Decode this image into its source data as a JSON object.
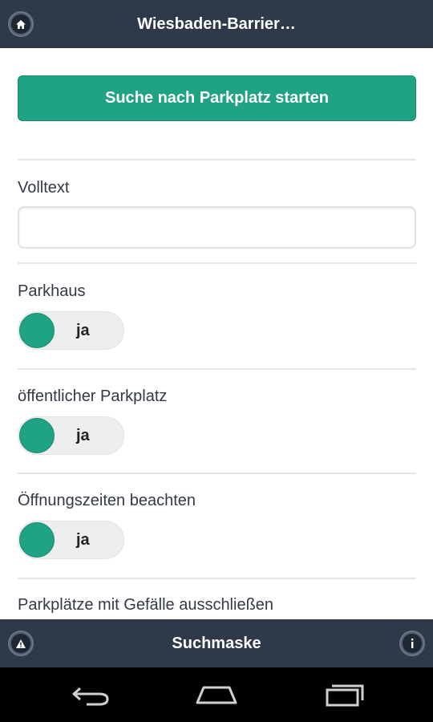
{
  "header": {
    "title": "Wiesbaden-Barrier…",
    "home_icon": "home-icon"
  },
  "search_button": {
    "label": "Suche nach Parkplatz starten"
  },
  "fulltext": {
    "label": "Volltext",
    "value": "",
    "placeholder": ""
  },
  "filters": [
    {
      "label": "Parkhaus",
      "toggle": "ja"
    },
    {
      "label": "öffentlicher Parkplatz",
      "toggle": "ja"
    },
    {
      "label": "Öffnungszeiten beachten",
      "toggle": "ja"
    },
    {
      "label": "Parkplätze mit Gefälle ausschließen"
    }
  ],
  "footer": {
    "title": "Suchmaske",
    "left_icon": "warning-icon",
    "right_icon": "info-icon"
  },
  "system_nav": {
    "back_icon": "back-icon",
    "home_icon": "home-icon",
    "recents_icon": "recents-icon"
  },
  "colors": {
    "bar": "#2e3a4a",
    "accent": "#1fa384",
    "toggle_track": "#eeeeee"
  }
}
